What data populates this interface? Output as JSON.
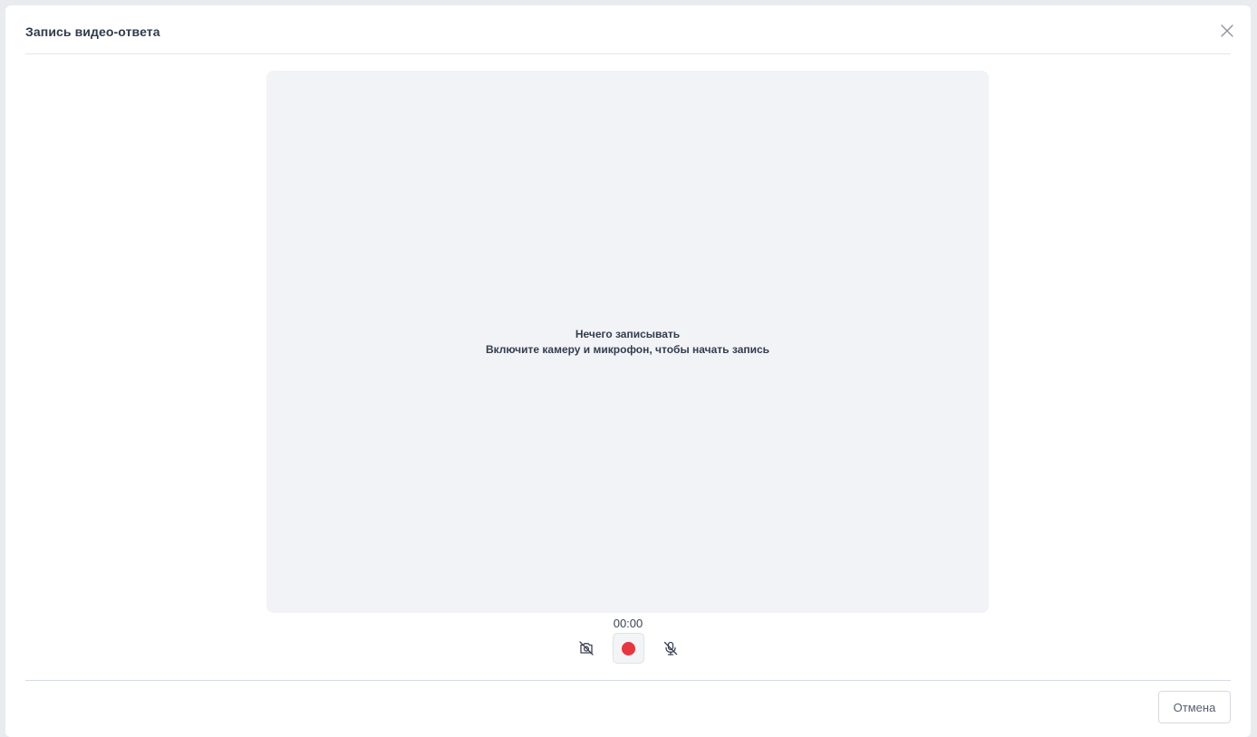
{
  "modal": {
    "title": "Запись видео-ответа",
    "close_icon": "close-icon"
  },
  "video": {
    "empty_title": "Нечего записывать",
    "empty_description": "Включите камеру и микрофон, чтобы начать запись"
  },
  "recorder": {
    "timer": "00:00",
    "camera_icon": "camera-off-icon",
    "record_icon": "record-icon",
    "mic_icon": "microphone-off-icon",
    "record_color": "#e8353f"
  },
  "footer": {
    "cancel_label": "Отмена"
  }
}
